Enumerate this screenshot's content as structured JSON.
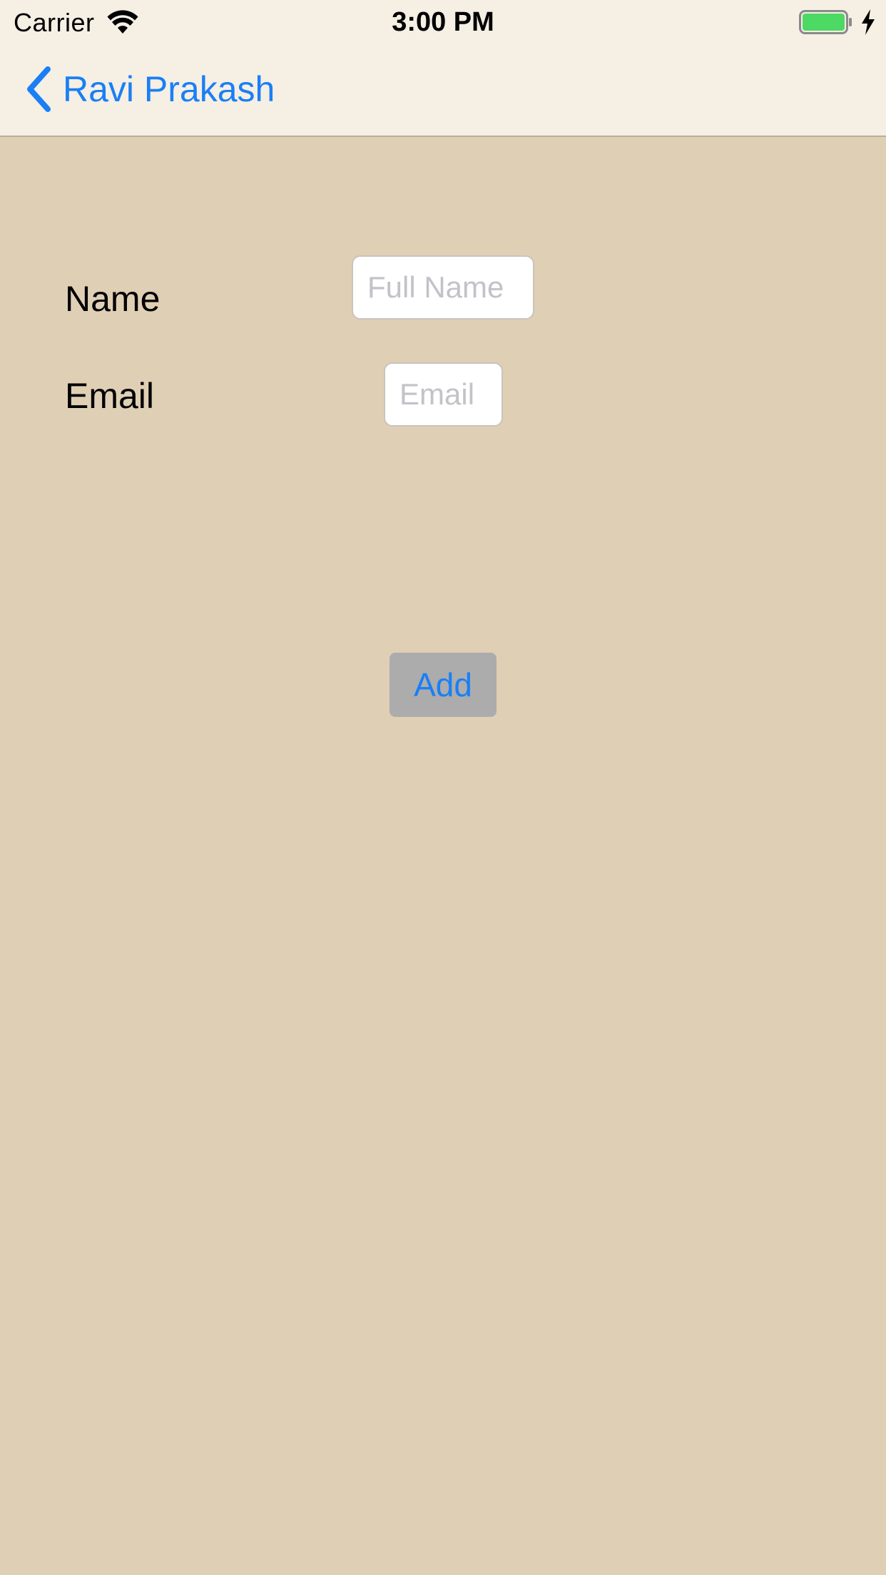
{
  "status_bar": {
    "carrier": "Carrier",
    "time": "3:00 PM"
  },
  "nav": {
    "back_label": "Ravi Prakash"
  },
  "form": {
    "name_label": "Name",
    "name_placeholder": "Full Name",
    "name_value": "",
    "email_label": "Email",
    "email_placeholder": "Email",
    "email_value": "",
    "add_label": "Add"
  },
  "colors": {
    "background": "#dfcfb5",
    "nav_background": "#f5efe4",
    "accent": "#1a7ff5",
    "button_background": "#acacac",
    "battery_fill": "#4cd964"
  },
  "icons": {
    "signal": "wifi-icon",
    "battery": "battery-icon",
    "charging": "charging-bolt-icon",
    "back": "chevron-left-icon"
  },
  "battery_level": 1.0
}
